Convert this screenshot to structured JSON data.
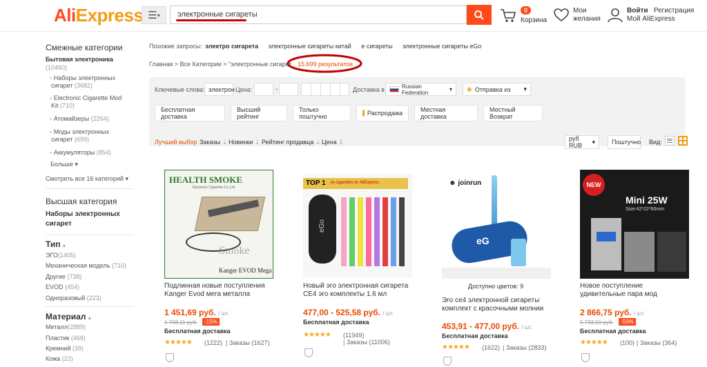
{
  "header": {
    "logo": "AliExpress",
    "search_value": "электронные сигареты",
    "cart_count": "0",
    "cart_label": "Корзина",
    "wishlist_line1": "Мои",
    "wishlist_line2": "желания",
    "login": "Войти",
    "register": "Регистрация",
    "my_account": "Мой AliExpress"
  },
  "related": {
    "label": "Похожие запросы:",
    "items": [
      "электро сигарета",
      "электронные сигареты китай",
      "е сигареты",
      "электронные сигареты eGo"
    ]
  },
  "breadcrumb": {
    "home": "Главная",
    "all": "Все Категории",
    "query": "\"электронные сигарет",
    "results": "15,699 результатов"
  },
  "sidebar": {
    "related_title": "Смежные категории",
    "parent": "Бытовая электроника",
    "parent_count": "(10460)",
    "cats": [
      {
        "line1": "Наборы электронных",
        "line2": "сигарет",
        "count": "(3682)"
      },
      {
        "line1": "Electronic Cigarette Mod",
        "line2": "Kit",
        "count": "(710)"
      },
      {
        "line1": "Атомайзеры",
        "line2": "",
        "count": "(2264)"
      },
      {
        "line1": "Моды электронных",
        "line2": "сигарет",
        "count": "(699)"
      },
      {
        "line1": "Аккумуляторы",
        "line2": "",
        "count": "(854)"
      }
    ],
    "more": "Больше",
    "see_all": "Смотреть все 16 категорий",
    "top_title": "Высшая категория",
    "top_line1": "Наборы электронных",
    "top_line2": "сигарет",
    "type_title": "Тип",
    "types": [
      {
        "name": "ЭГО",
        "count": "(1405)"
      },
      {
        "name": "Механическая модель",
        "count": "(710)"
      },
      {
        "name": "Другие",
        "count": "(738)"
      },
      {
        "name": "EVOD",
        "count": "(454)"
      },
      {
        "name": "Одноразовый",
        "count": "(223)"
      }
    ],
    "material_title": "Материал",
    "materials": [
      {
        "name": "Металл",
        "count": "(2889)"
      },
      {
        "name": "Пластик",
        "count": "(468)"
      },
      {
        "name": "Кремний",
        "count": "(39)"
      },
      {
        "name": "Кожа",
        "count": "(22)"
      }
    ]
  },
  "filters": {
    "keywords_label": "Ключевые слова:",
    "keywords_value": "электрон",
    "price_label": "Цена:",
    "price_dash": "-",
    "ship_to_label": "Доставка в",
    "ship_to_value": "Russian Federation",
    "ship_from_value": "Отправка из",
    "buttons": [
      "Бесплатная доставка",
      "Высший рейтинг",
      "Только поштучно",
      "Распродажа",
      "Местная доставка",
      "Местный Возврат"
    ]
  },
  "sort": {
    "best": "Лучший выбор",
    "orders": "Заказы",
    "new": "Новинки",
    "seller_rating": "Рейтинг продавца",
    "price": "Цена",
    "currency": "руб RUB",
    "per_piece": "Поштучно",
    "view_label": "Вид:"
  },
  "products": [
    {
      "img_brand": "HEALTH SMOKE",
      "img_sub": "Electronic Cigarette Co.,Ltd",
      "img_caption": "Kanger EVOD Mega",
      "title_line1": "Подлинная новые поступления",
      "title_line2": "Kanger Evod мега металла",
      "price": "1 451,69 руб.",
      "unit": "/ шт.",
      "old_price": "1 708,11 руб.",
      "discount": "-15%",
      "shipping": "Бесплатная доставка",
      "reviews": "(1222)",
      "orders": "Заказы (1627)"
    },
    {
      "img_banner": "TOP 1",
      "img_banner_sub": "(e cigarette) on AliExpress",
      "img_case_label": "eGo",
      "title_line1": "Новый эго электронная сигарета",
      "title_line2": "CE4 эго комплекты 1.6 мл",
      "price": "477,00 - 525,58 руб.",
      "unit": "/ шт.",
      "shipping": "Бесплатная доставка",
      "reviews": "(11949)",
      "orders": "Заказы (11006)"
    },
    {
      "img_brand": "joinrun",
      "img_case_label": "eG",
      "colors": "Доступно цветов: 9",
      "title_line1": "Эго ce4 электронной сигареты",
      "title_line2": "комплект с красочными молнии",
      "price": "453,91 - 477,00 руб.",
      "unit": "/ шт.",
      "shipping": "Бесплатная доставка",
      "reviews": "(1622)",
      "orders": "Заказы (2833)"
    },
    {
      "img_new": "NEW",
      "img_title": "Mini 25W",
      "img_size": "Size:42*22*60mm",
      "title_line1": "Новое поступление",
      "title_line2": "удивительные пара мод",
      "price": "2 866,75 руб.",
      "unit": "/ шт.",
      "old_price": "5 733,50 руб.",
      "discount": "-50%",
      "shipping": "Бесплатная доставка",
      "reviews": "(100)",
      "orders": "Заказы (364)"
    }
  ],
  "icons": {
    "menu": "hamburger-icon",
    "search": "search-icon",
    "cart": "cart-icon",
    "wish": "heart-icon",
    "user": "user-icon"
  },
  "colors": {
    "accent": "#ff4a1a",
    "price": "#e64b00",
    "star": "#f5a623",
    "highlight_circle": "#c00000"
  }
}
